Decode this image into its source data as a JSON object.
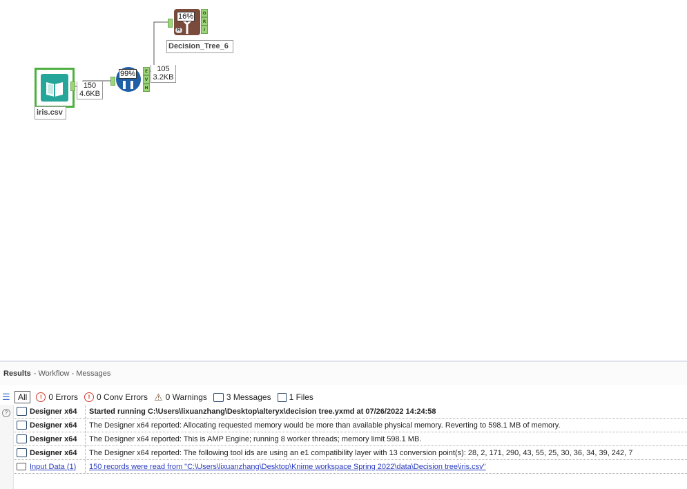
{
  "canvas": {
    "tools": {
      "input": {
        "label": "iris.csv"
      },
      "create_samples": {
        "percent": "99%",
        "anchors": [
          "E",
          "V",
          "H"
        ]
      },
      "decision_tree": {
        "label": "Decision_Tree_6",
        "percent": "16%",
        "anchors": [
          "O",
          "R",
          "I"
        ]
      }
    },
    "connections": {
      "c1": {
        "records": "150",
        "size": "4.6KB"
      },
      "c2": {
        "records": "105",
        "size": "3.2KB"
      }
    },
    "colors": {
      "input_green": "#4caf3f",
      "teal": "#26a69a",
      "blue": "#1f5fa8",
      "brown": "#7a4a3a",
      "anchor_green": "#9fd37a"
    }
  },
  "results": {
    "title": "Results",
    "breadcrumb": "- Workflow - Messages",
    "filters": {
      "all": "All",
      "errors": "0 Errors",
      "conv_errors": "0 Conv Errors",
      "warnings": "0 Warnings",
      "messages": "3 Messages",
      "files": "1 Files"
    },
    "rows": [
      {
        "source": "Designer x64",
        "message": "Started running C:\\Users\\lixuanzhang\\Desktop\\alteryx\\decision tree.yxmd at 07/26/2022 14:24:58",
        "icon": "message-icon"
      },
      {
        "source": "Designer x64",
        "message": "The Designer x64 reported: Allocating requested memory would be more than available physical memory. Reverting to 598.1 MB of memory.",
        "icon": "message-icon"
      },
      {
        "source": "Designer x64",
        "message": "The Designer x64 reported: This is AMP Engine; running 8 worker threads; memory limit 598.1 MB.",
        "icon": "message-icon"
      },
      {
        "source": "Designer x64",
        "message": "The Designer x64 reported: The following tool ids are using an e1 compatibility layer with 13 conversion point(s): 28, 2, 171, 290, 43, 55, 25, 30, 36, 34, 39, 242, 7",
        "icon": "message-icon"
      },
      {
        "source": "Input Data (1)",
        "message": "150 records were read from \"C:\\Users\\lixuanzhang\\Desktop\\Knime workspace Spring 2022\\data\\Decision tree\\iris.csv\"",
        "icon": "file-icon"
      }
    ]
  }
}
